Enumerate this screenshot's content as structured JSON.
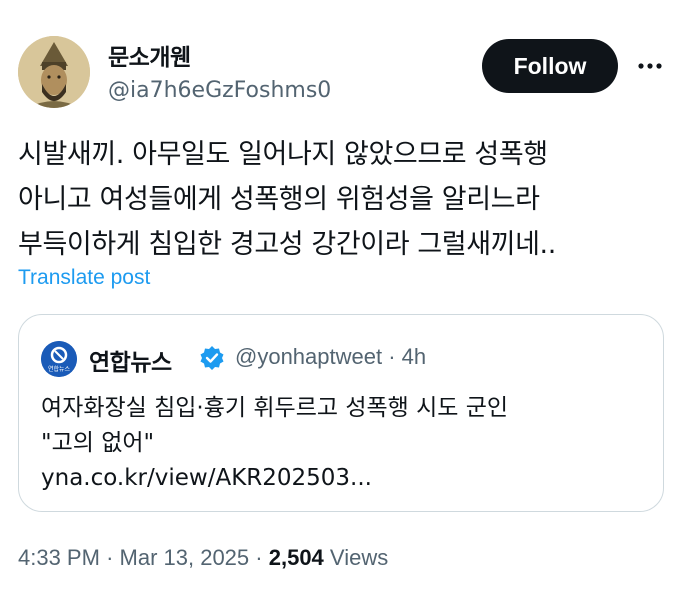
{
  "author": {
    "display_name": "문소개웬",
    "handle": "@ia7h6eGzFoshms0"
  },
  "follow_button": {
    "label": "Follow"
  },
  "post": {
    "lines": [
      "시발새끼. 아무일도 일어나지 않았으므로 성폭행",
      "아니고 여성들에게 성폭행의 위험성을 알리느라",
      "부득이하게 침입한 경고성 강간이라 그럴새끼네.."
    ],
    "translate_label": "Translate post"
  },
  "quoted_post": {
    "account_name": "연합뉴스",
    "handle": "@yonhaptweet",
    "separator": "·",
    "time_ago": "4h",
    "text_lines": [
      "여자화장실 침입·흉기 휘두르고 성폭행 시도 군인",
      "\"고의 없어\""
    ],
    "link_text": "yna.co.kr/view/AKR202503...",
    "logo_text": "연합뉴스"
  },
  "footer": {
    "time": "4:33 PM",
    "separator": "·",
    "date": "Mar 13, 2025",
    "views_count": "2,504",
    "views_label": "Views"
  },
  "colors": {
    "accent": "#1d9bf0",
    "button_bg": "#0f1419",
    "secondary_text": "#536471",
    "border": "#cfd9de",
    "yonhap_blue": "#1a5bb8"
  }
}
